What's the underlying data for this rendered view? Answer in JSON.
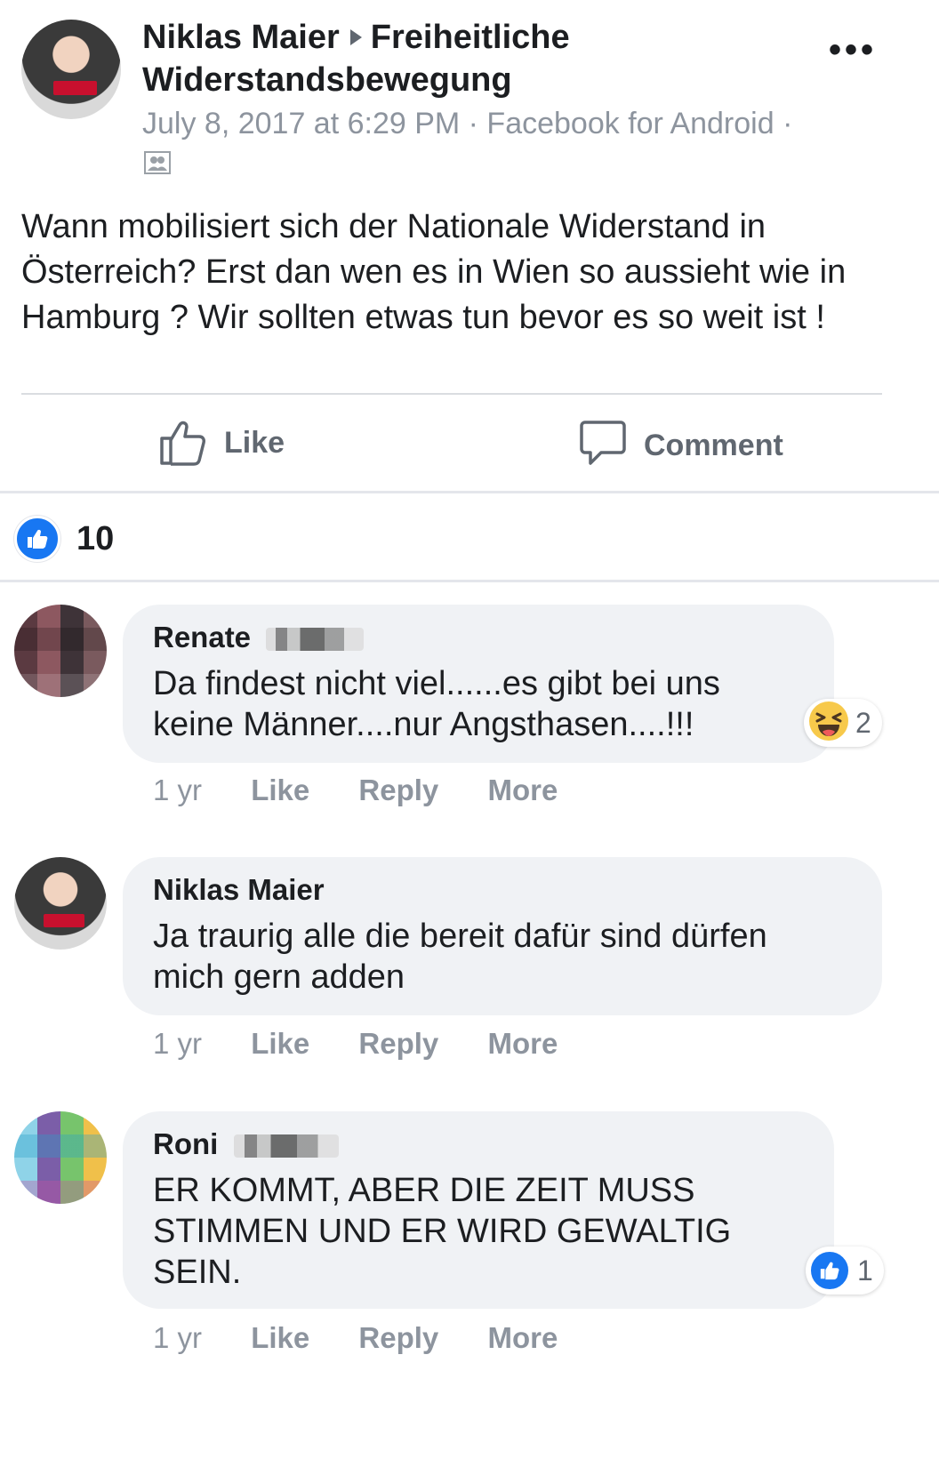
{
  "post": {
    "author": "Niklas Maier",
    "group": "Freiheitliche",
    "group_line2": "Widerstandsbewegung",
    "meta": "July 8, 2017 at 6:29 PM · Facebook for Android ·",
    "text_line1": "Wann mobilisiert sich der Nationale Widerstand in",
    "text_line2": "Österreich? Erst dan wen es in Wien so aussieht wie in",
    "text_line3": "Hamburg ? Wir sollten etwas tun bevor es so weit ist !",
    "more_label": "•••"
  },
  "actions": {
    "like_label": "Like",
    "comment_label": "Comment"
  },
  "reactions": {
    "count": "10",
    "icon": "thumbs-up-icon",
    "color": "#1877f2"
  },
  "comments": [
    {
      "name": "Renate",
      "line1": "Da findest nicht viel......es gibt bei uns",
      "line2": "keine Männer....nur Angsthasen....!!!",
      "time": "1 yr",
      "like": "Like",
      "reply": "Reply",
      "more": "More",
      "reaction_count": "2",
      "reaction_icon": "laughing-face-icon"
    },
    {
      "name": "Niklas Maier",
      "line1": "Ja traurig alle die bereit dafür sind dürfen",
      "line2": "mich gern adden",
      "time": "1 yr",
      "like": "Like",
      "reply": "Reply",
      "more": "More"
    },
    {
      "name": "Roni",
      "line1": "ER KOMMT, ABER DIE ZEIT MUSS",
      "line2": "STIMMEN UND ER WIRD GEWALTIG",
      "line3": "SEIN.",
      "time": "1 yr",
      "like": "Like",
      "reply": "Reply",
      "more": "More",
      "reaction_count": "1",
      "reaction_icon": "thumbs-up-icon"
    }
  ]
}
